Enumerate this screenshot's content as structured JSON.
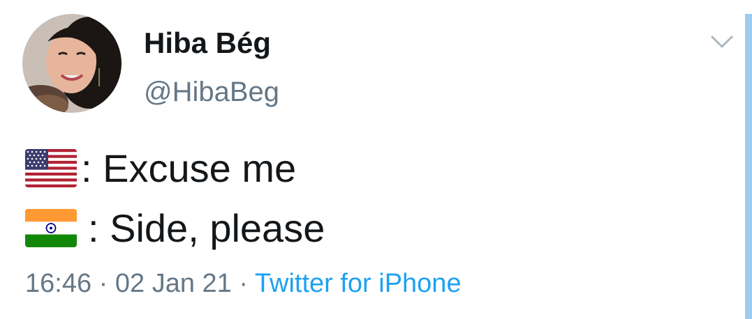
{
  "tweet": {
    "author": {
      "display_name": "Hiba Bég",
      "handle": "@HibaBeg",
      "avatar_icon": "profile-photo"
    },
    "menu_icon": "chevron-down-icon",
    "lines": [
      {
        "flag_icon": "us-flag-icon",
        "text": ": Excuse me"
      },
      {
        "flag_icon": "india-flag-icon",
        "text": ": Side, please"
      }
    ],
    "meta": {
      "time": "16:46",
      "separator": "·",
      "date": "02 Jan 21",
      "source": "Twitter for iPhone"
    }
  },
  "colors": {
    "text": "#14171a",
    "muted": "#657786",
    "link": "#1da1f2",
    "accent_bar": "#9ecbf0"
  }
}
